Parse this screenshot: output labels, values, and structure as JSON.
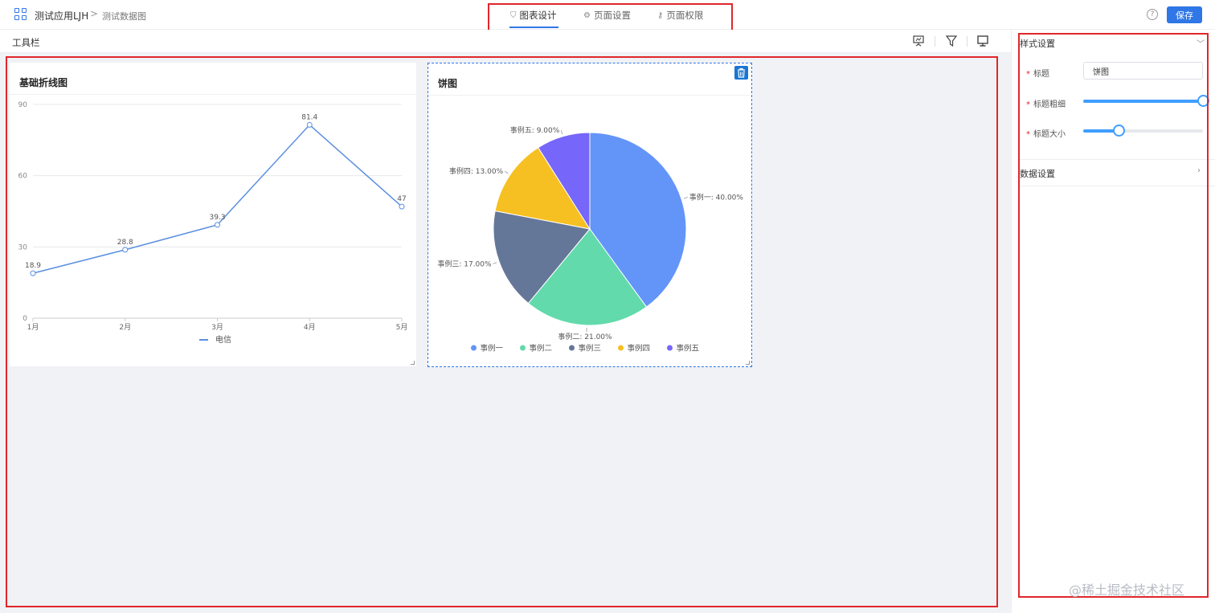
{
  "header": {
    "app_name": "测试应用LJH",
    "separator": ">",
    "page_name": "测试数据图",
    "tabs": [
      {
        "label": "图表设计",
        "icon": "chart-design-icon",
        "active": true
      },
      {
        "label": "页面设置",
        "icon": "gear-icon",
        "active": false
      },
      {
        "label": "页面权限",
        "icon": "key-icon",
        "active": false
      }
    ],
    "help": "?",
    "save_label": "保存",
    "accent": "#2f76e6"
  },
  "toolbar": {
    "label": "工具栏",
    "icons": [
      "presentation-icon",
      "filter-icon",
      "monitor-icon"
    ]
  },
  "cards": {
    "line": {
      "title": "基础折线图"
    },
    "pie": {
      "title": "饼图"
    }
  },
  "chart_data": [
    {
      "type": "line",
      "title": "基础折线图",
      "categories": [
        "1月",
        "2月",
        "3月",
        "4月",
        "5月"
      ],
      "series": [
        {
          "name": "电信",
          "values": [
            18.9,
            28.8,
            39.3,
            81.4,
            47
          ],
          "color": "#5b8fe0"
        }
      ],
      "yticks": [
        0,
        30,
        60,
        90
      ],
      "ylim": [
        0,
        90
      ],
      "grid": true,
      "legend": "bottom-center"
    },
    {
      "type": "pie",
      "title": "饼图",
      "slices": [
        {
          "name": "事例一",
          "value": 40,
          "label": "事例一: 40.00%",
          "color": "#6395f9"
        },
        {
          "name": "事例二",
          "value": 21,
          "label": "事例二: 21.00%",
          "color": "#62daab"
        },
        {
          "name": "事例三",
          "value": 17,
          "label": "事例三: 17.00%",
          "color": "#657798"
        },
        {
          "name": "事例四",
          "value": 13,
          "label": "事例四: 13.00%",
          "color": "#f6c022"
        },
        {
          "name": "事例五",
          "value": 9,
          "label": "事例五: 9.00%",
          "color": "#7666f9"
        }
      ],
      "legend": "bottom-center"
    }
  ],
  "panel": {
    "style_section": "样式设置",
    "title_label": "标题",
    "title_value": "饼图",
    "title_weight_label": "标题粗细",
    "title_weight_level": 1.0,
    "title_size_label": "标题大小",
    "title_size_level": 0.3,
    "data_section": "数据设置",
    "slider_color": "#409eff"
  },
  "watermark": "@稀土掘金技术社区"
}
